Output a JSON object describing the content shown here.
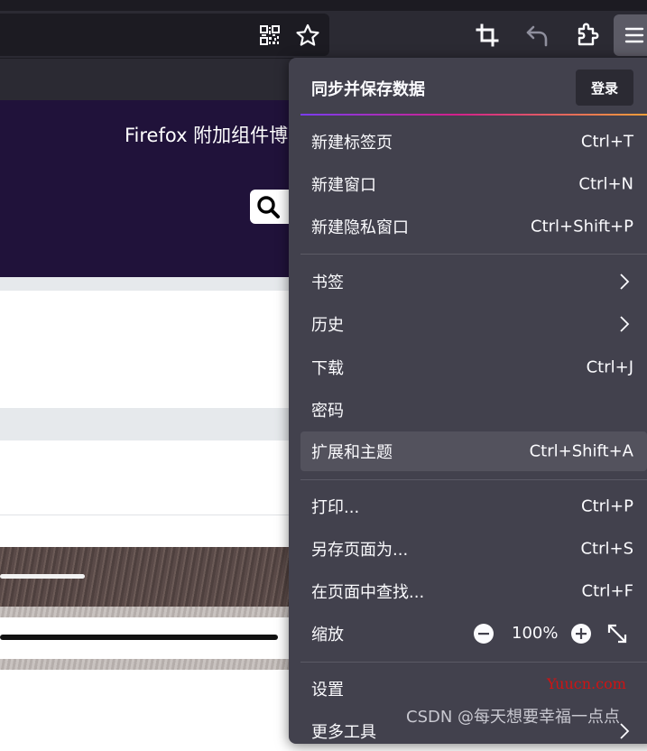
{
  "browser": {
    "toolbar_icons": [
      "qr-code-icon",
      "bookmark-star-icon",
      "screenshot-crop-icon",
      "undo-icon",
      "extensions-puzzle-icon",
      "hamburger-menu-icon"
    ]
  },
  "page": {
    "title": "Firefox 附加组件博客",
    "header_color": "#20123a"
  },
  "menu": {
    "sync_title": "同步并保存数据",
    "login_label": "登录",
    "accent_gradient": [
      "#7a3cf2",
      "#d3208b",
      "#f29f39"
    ],
    "items": [
      {
        "label": "新建标签页",
        "shortcut": "Ctrl+T"
      },
      {
        "label": "新建窗口",
        "shortcut": "Ctrl+N"
      },
      {
        "label": "新建隐私窗口",
        "shortcut": "Ctrl+Shift+P"
      },
      {
        "label": "书签",
        "shortcut": ""
      },
      {
        "label": "历史",
        "shortcut": ""
      },
      {
        "label": "下载",
        "shortcut": "Ctrl+J"
      },
      {
        "label": "密码",
        "shortcut": ""
      },
      {
        "label": "扩展和主题",
        "shortcut": "Ctrl+Shift+A",
        "highlighted": true
      },
      {
        "label": "打印...",
        "shortcut": "Ctrl+P"
      },
      {
        "label": "另存页面为...",
        "shortcut": "Ctrl+S"
      },
      {
        "label": "在页面中查找...",
        "shortcut": "Ctrl+F"
      },
      {
        "label": "缩放",
        "shortcut": ""
      },
      {
        "label": "设置",
        "shortcut": ""
      },
      {
        "label": "更多工具",
        "shortcut": ""
      }
    ],
    "zoom": {
      "value": "100%"
    }
  },
  "watermarks": {
    "site": "Yuucn.com",
    "csdn": "CSDN @每天想要幸福一点点"
  }
}
